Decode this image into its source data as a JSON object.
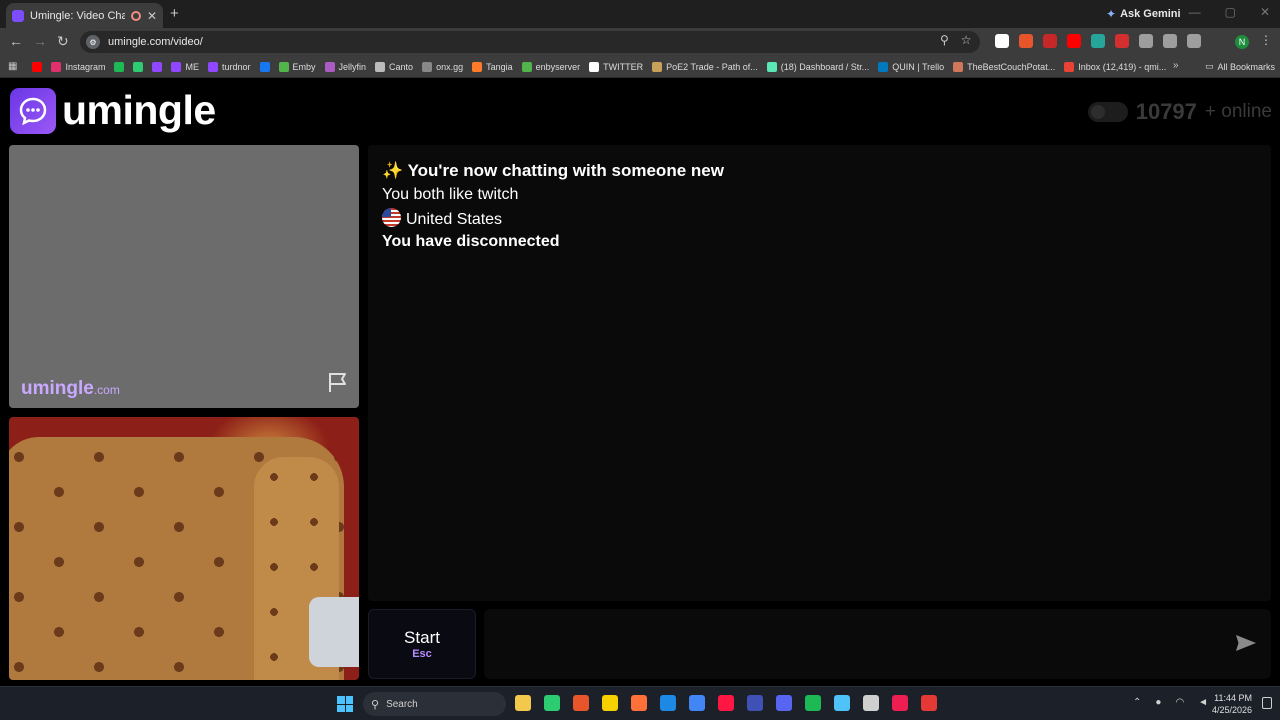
{
  "browser": {
    "tab_title": "Umingle: Video Chat with S",
    "new_tab": "+",
    "ask_gemini": "Ask Gemini",
    "url": "umingle.com/video/",
    "bookmarks": [
      {
        "label": "",
        "color": "#ff0000"
      },
      {
        "label": "Instagram",
        "color": "#e1306c"
      },
      {
        "label": "",
        "color": "#1db954"
      },
      {
        "label": "",
        "color": "#2ecc71"
      },
      {
        "label": "",
        "color": "#9146ff"
      },
      {
        "label": "ME",
        "color": "#9146ff"
      },
      {
        "label": "turdnor",
        "color": "#9146ff"
      },
      {
        "label": "",
        "color": "#1877f2"
      },
      {
        "label": "Emby",
        "color": "#52b54b"
      },
      {
        "label": "Jellyfin",
        "color": "#aa5cc3"
      },
      {
        "label": "Canto",
        "color": "#bbbbbb"
      },
      {
        "label": "onx.gg",
        "color": "#888888"
      },
      {
        "label": "Tangia",
        "color": "#ff7a29"
      },
      {
        "label": "enbyserver",
        "color": "#52b54b"
      },
      {
        "label": "TWITTER",
        "color": "#ffffff"
      },
      {
        "label": "PoE2 Trade - Path of...",
        "color": "#c7a15a"
      },
      {
        "label": "(18) Dashboard / Str...",
        "color": "#5be6b5"
      },
      {
        "label": "QUIN | Trello",
        "color": "#0079bf"
      },
      {
        "label": "TheBestCouchPotat...",
        "color": "#d0765b"
      },
      {
        "label": "Inbox (12,419) - qmi...",
        "color": "#ea4335"
      }
    ],
    "all_bookmarks": "All Bookmarks",
    "profile_initial": "N"
  },
  "page": {
    "logo_text": "umingle",
    "online_count": "10797",
    "online_suffix": "+ online",
    "watermark_main": "umingle",
    "watermark_com": ".com",
    "chat": {
      "title": "✨ You're now chatting with someone new",
      "interest": "You both like twitch",
      "country": "United States",
      "status": "You have disconnected"
    },
    "start_label": "Start",
    "start_key": "Esc",
    "message_placeholder": ""
  },
  "taskbar": {
    "search_label": "Search",
    "time": "11:44 PM",
    "date": "4/25/2026",
    "apps": [
      "#f2c94c",
      "#2ecc71",
      "#e8552b",
      "#f7d000",
      "#ff7139",
      "#1e88e5",
      "#4285f4",
      "#ff1744",
      "#3f51b5",
      "#5865f2",
      "#1db954",
      "#4fc3f7",
      "#cfcfcf",
      "#ee1d52",
      "#e53935"
    ]
  },
  "colors": {
    "brand_purple": "#7c4dff",
    "accent_key": "#b48cff"
  }
}
